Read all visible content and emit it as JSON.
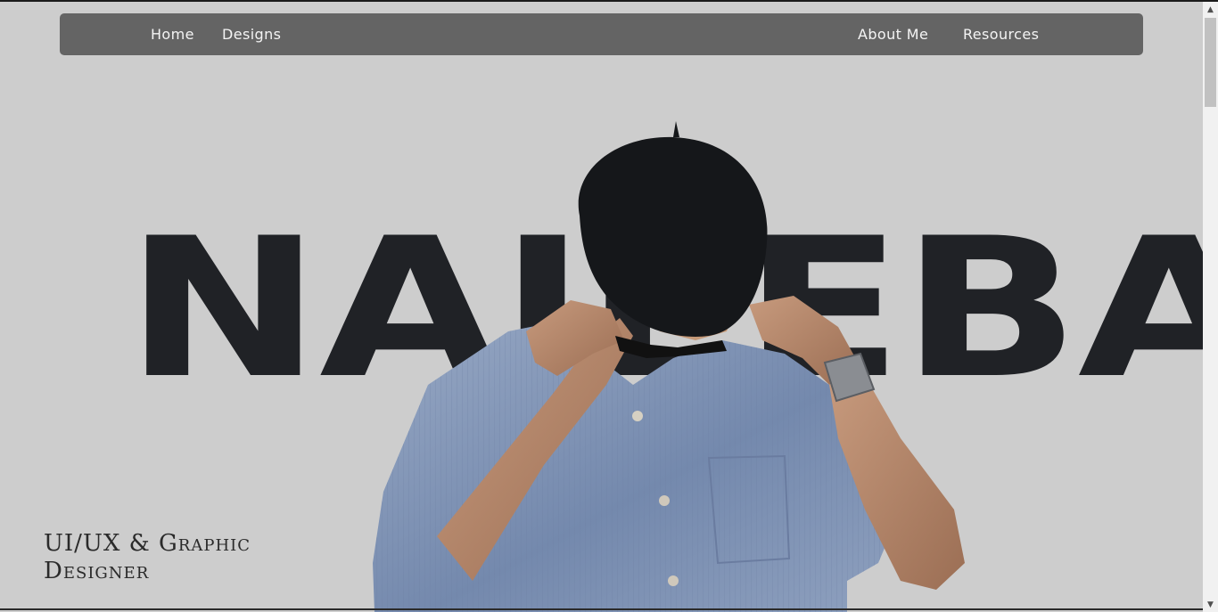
{
  "nav": {
    "home": "Home",
    "designs": "Designs",
    "about": "About Me",
    "resources": "Resources"
  },
  "hero": {
    "name": "NAJEEBA",
    "subtitle_line1": "UI/UX & Graphic",
    "subtitle_line2": "Designer"
  },
  "portrait": {
    "description_icon": "person-photo",
    "shirt_color": "#7f93b3",
    "hair_color": "#15171a"
  },
  "colors": {
    "background": "#cdcdcd",
    "navbar": "#646464",
    "hero_text": "#202226"
  }
}
